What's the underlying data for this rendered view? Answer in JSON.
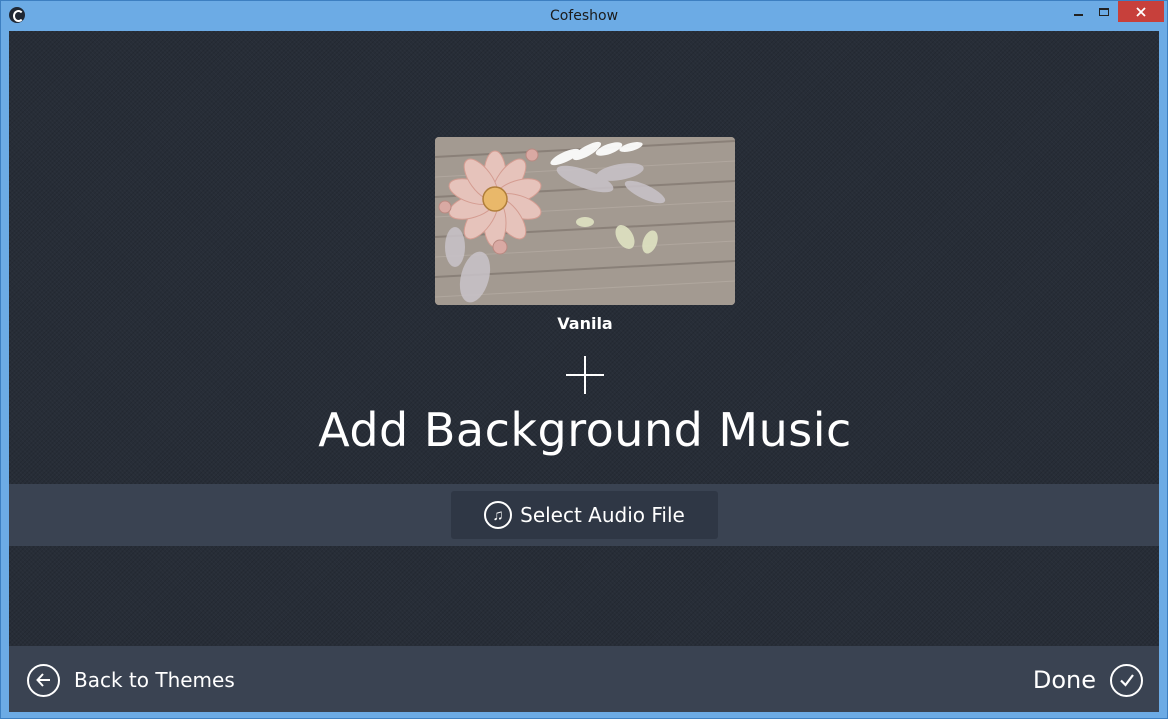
{
  "window": {
    "title": "Cofeshow"
  },
  "theme": {
    "name": "Vanila"
  },
  "main": {
    "heading": "Add Background Music",
    "select_audio_label": "Select Audio File"
  },
  "footer": {
    "back_label": "Back to Themes",
    "done_label": "Done"
  },
  "colors": {
    "background": "#272d37",
    "band": "#3a4352",
    "title_bar": "#6cabe5",
    "close_button": "#c7403b",
    "text": "#ffffff"
  },
  "icons": [
    "app-logo-icon",
    "minimize-icon",
    "maximize-icon",
    "close-icon",
    "plus-icon",
    "music-note-icon",
    "arrow-left-icon",
    "checkmark-icon"
  ]
}
